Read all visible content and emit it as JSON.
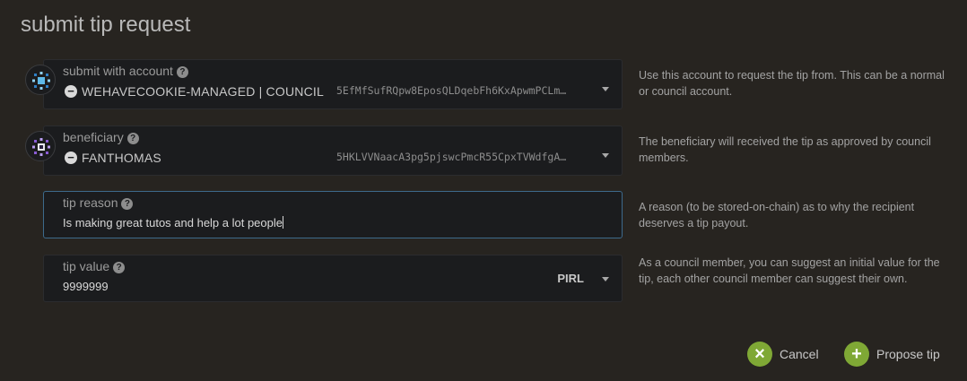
{
  "modal": {
    "title": "submit tip request"
  },
  "fields": {
    "account": {
      "label": "submit with account",
      "name": "WEHAVECOOKIE-MANAGED | COUNCIL",
      "address": "5EfMfSufRQpw8EposQLDqebFh6KxApwmPCLm…",
      "help": "Use this account to request the tip from. This can be a normal or council account."
    },
    "beneficiary": {
      "label": "beneficiary",
      "name": "FANTHOMAS",
      "address": "5HKLVVNaacA3pg5pjswcPmcR55CpxTVWdfgA…",
      "help": "The beneficiary will received the tip as approved by council members."
    },
    "reason": {
      "label": "tip reason",
      "value": "Is making great tutos and help a lot people",
      "help": "A reason (to be stored-on-chain) as to why the recipient deserves a tip payout."
    },
    "value": {
      "label": "tip value",
      "value": "9999999",
      "unit": "PIRL",
      "help": "As a council member, you can suggest an initial value for the tip, each other council member can suggest their own."
    }
  },
  "buttons": {
    "cancel": {
      "label": "Cancel",
      "icon": "×"
    },
    "propose": {
      "label": "Propose tip",
      "icon": "+"
    }
  },
  "colors": {
    "accent": "#7fa835",
    "focus": "#3d6a8c"
  }
}
